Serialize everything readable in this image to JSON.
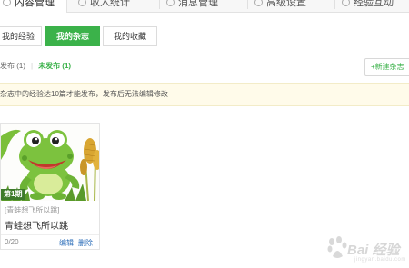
{
  "topnav": {
    "tabs": [
      {
        "label": "内容管理",
        "icon": "document-icon"
      },
      {
        "label": "收入统计",
        "icon": "chart-icon"
      },
      {
        "label": "消息管理",
        "icon": "mail-icon"
      },
      {
        "label": "高级设置",
        "icon": "gear-icon"
      },
      {
        "label": "经验互动",
        "icon": "chat-icon"
      }
    ]
  },
  "subtabs": [
    "我的经验",
    "我的杂志",
    "我的收藏"
  ],
  "filter": {
    "published": "发布 (1)",
    "separator": "|",
    "unpublished": "未发布 (1)"
  },
  "new_button": "+新建杂志",
  "notice": "杂志中的经验达10篇才能发布，发布后无法编辑修改",
  "card": {
    "issue": "第1期",
    "subtitle": "[青蛙想飞所以跳]",
    "title": "青蛙想飞所以跳",
    "count": "0/20",
    "edit": "编辑",
    "delete": "删除"
  },
  "watermark": {
    "text": "Bai 经验",
    "sub": "jingyan.baidu.com"
  },
  "colors": {
    "accent": "#3bb24a",
    "link": "#2a6cb8",
    "notice_bg": "#fffbea"
  }
}
